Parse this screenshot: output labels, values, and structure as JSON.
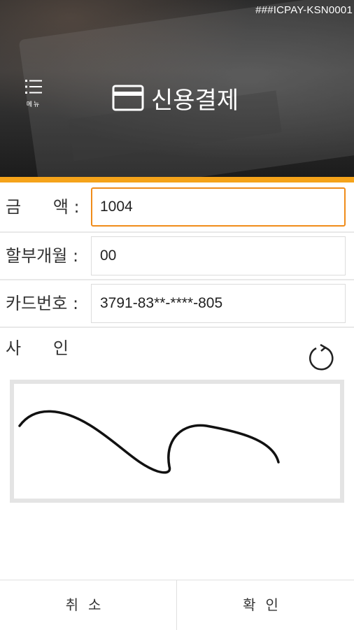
{
  "header": {
    "code": "###ICPAY-KSN0001",
    "menu_label": "메뉴",
    "title": "신용결제"
  },
  "form": {
    "amount": {
      "label": "금      액 :",
      "value": "1004"
    },
    "installment": {
      "label": "할부개월 :",
      "value": "00"
    },
    "card_number": {
      "label": "카드번호 :",
      "value": "3791-83**-****-805"
    }
  },
  "signature": {
    "label": "사      인"
  },
  "buttons": {
    "cancel": "취소",
    "confirm": "확인"
  },
  "colors": {
    "accent": "#f5a31a",
    "active_border": "#f08c1a"
  },
  "icons": {
    "menu": "menu-icon",
    "card": "credit-card-icon",
    "reset": "refresh-icon"
  }
}
